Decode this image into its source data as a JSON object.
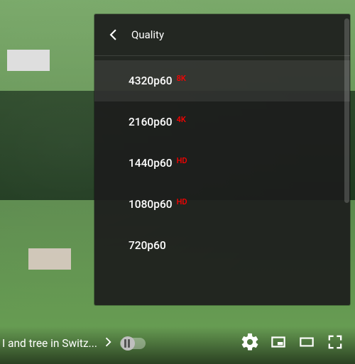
{
  "menu": {
    "title": "Quality",
    "items": [
      {
        "label": "4320p60",
        "badge": "8K",
        "active": true
      },
      {
        "label": "2160p60",
        "badge": "4K",
        "active": false
      },
      {
        "label": "1440p60",
        "badge": "HD",
        "active": false
      },
      {
        "label": "1080p60",
        "badge": "HD",
        "active": false
      },
      {
        "label": "720p60",
        "badge": "",
        "active": false
      }
    ]
  },
  "controls": {
    "title": "I and tree in Switz..."
  }
}
